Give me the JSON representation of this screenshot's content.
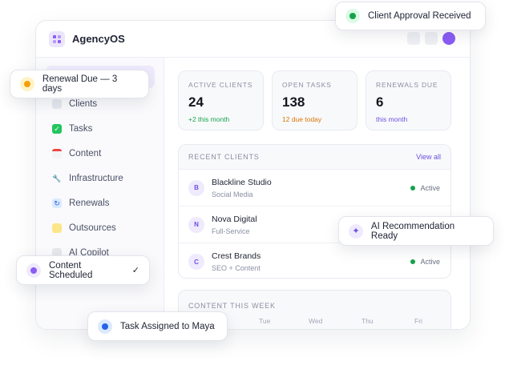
{
  "app": {
    "title": "AgencyOS"
  },
  "colors": {
    "accent": "#8b5cf6",
    "green": "#16a34a",
    "orange": "#d97706",
    "purple": "#6d4fe0",
    "blue": "#2563eb"
  },
  "sidebar": {
    "items": [
      {
        "label": "Clients",
        "icon": "users-icon"
      },
      {
        "label": "Tasks",
        "icon": "checkbox-icon"
      },
      {
        "label": "Content",
        "icon": "calendar-icon"
      },
      {
        "label": "Infrastructure",
        "icon": "wrench-icon"
      },
      {
        "label": "Renewals",
        "icon": "refresh-icon"
      },
      {
        "label": "Outsources",
        "icon": "handshake-icon"
      },
      {
        "label": "AI Copilot",
        "icon": "robot-icon"
      }
    ]
  },
  "stats": [
    {
      "label": "ACTIVE CLIENTS",
      "value": "24",
      "sub": "+2 this month"
    },
    {
      "label": "OPEN TASKS",
      "value": "138",
      "sub": "12 due today"
    },
    {
      "label": "RENEWALS DUE",
      "value": "6",
      "sub": "this month"
    }
  ],
  "recent_clients": {
    "title": "RECENT CLIENTS",
    "view_all": "View all",
    "rows": [
      {
        "initial": "B",
        "name": "Blackline Studio",
        "type": "Social Media",
        "status": "Active"
      },
      {
        "initial": "N",
        "name": "Nova Digital",
        "type": "Full-Service",
        "status": ""
      },
      {
        "initial": "C",
        "name": "Crest Brands",
        "type": "SEO + Content",
        "status": "Active"
      }
    ]
  },
  "content_week": {
    "title": "CONTENT THIS WEEK",
    "days": [
      "Tue",
      "Wed",
      "Thu",
      "Fri"
    ]
  },
  "toasts": {
    "client_approval": "Client Approval Received",
    "renewal_due": "Renewal Due — 3 days",
    "ai_recommendation": "AI Recommendation Ready",
    "content_scheduled": "Content Scheduled",
    "content_scheduled_check": "✓",
    "task_assigned": "Task Assigned to Maya"
  }
}
